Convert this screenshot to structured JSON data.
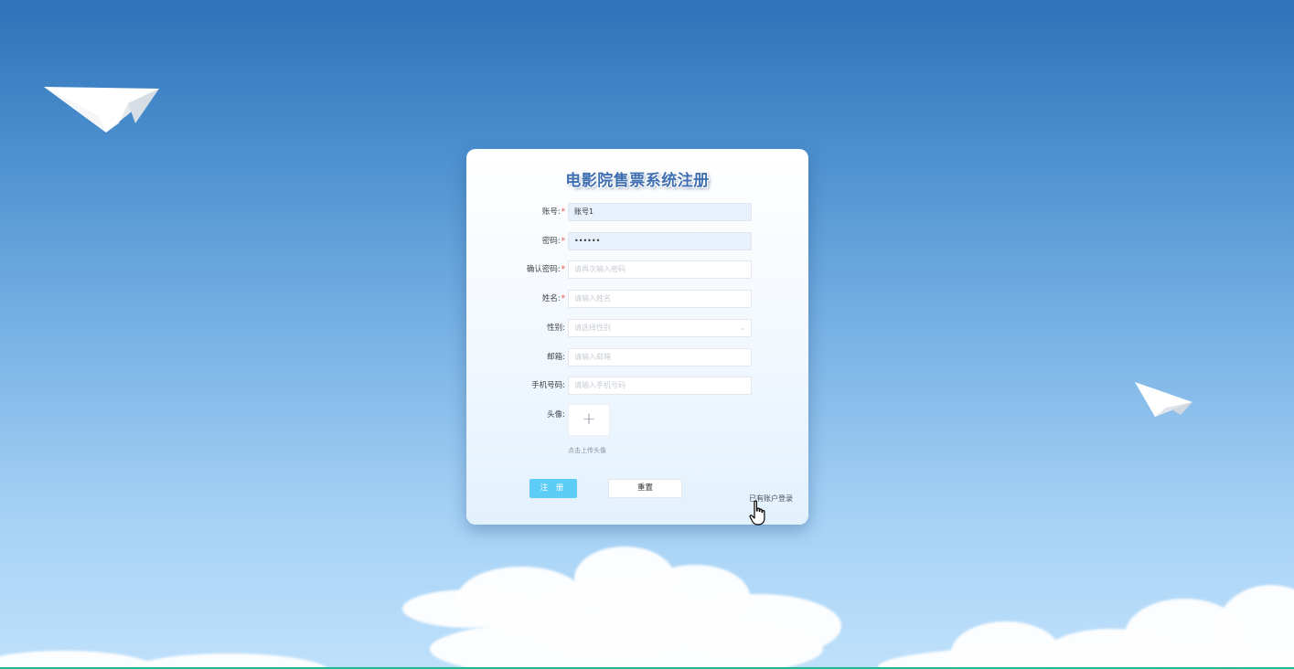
{
  "page": {
    "title": "电影院售票系统注册"
  },
  "form": {
    "account": {
      "label": "账号:",
      "required": "*",
      "value": "账号1"
    },
    "password": {
      "label": "密码:",
      "required": "*",
      "value": "••••••"
    },
    "confirm_password": {
      "label": "确认密码:",
      "required": "*",
      "placeholder": "请再次输入密码"
    },
    "name": {
      "label": "姓名:",
      "required": "*",
      "placeholder": "请输入姓名"
    },
    "gender": {
      "label": "性别:",
      "placeholder": "请选择性别"
    },
    "email": {
      "label": "邮箱:",
      "placeholder": "请输入邮箱"
    },
    "phone": {
      "label": "手机号码:",
      "placeholder": "请输入手机号码"
    },
    "avatar": {
      "label": "头像:",
      "upload_icon": "plus-icon",
      "upload_tip": "点击上传头像"
    }
  },
  "actions": {
    "register_label": "注 册",
    "reset_label": "重置",
    "login_link": "已有账户登录"
  },
  "colors": {
    "primary_button": "#5ccdf6",
    "required_star": "#e0473f",
    "title": "#3f6fb0"
  },
  "icons": {
    "chevron": "chevron-down-icon",
    "cursor": "hand-pointer-icon",
    "plane": "paper-plane-icon"
  }
}
